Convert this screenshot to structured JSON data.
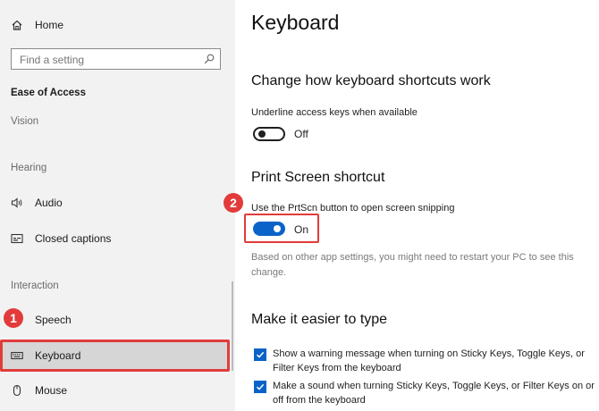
{
  "sidebar": {
    "home_label": "Home",
    "search_placeholder": "Find a setting",
    "category_title": "Ease of Access",
    "group_vision": "Vision",
    "group_hearing": "Hearing",
    "group_interaction": "Interaction",
    "items": {
      "audio": "Audio",
      "closed_captions": "Closed captions",
      "speech": "Speech",
      "keyboard": "Keyboard",
      "mouse": "Mouse"
    },
    "selected_item": "Keyboard"
  },
  "badges": {
    "first": "1",
    "second": "2"
  },
  "main": {
    "title": "Keyboard",
    "shortcuts_section": {
      "heading": "Change how keyboard shortcuts work",
      "underline_label": "Underline access keys when available",
      "underline_state": "Off"
    },
    "print_screen_section": {
      "heading": "Print Screen shortcut",
      "prtscn_label": "Use the PrtScn button to open screen snipping",
      "prtscn_state": "On",
      "note": "Based on other app settings, you might need to restart your PC to see this change."
    },
    "typing_section": {
      "heading": "Make it easier to type",
      "checkbox_warning": "Show a warning message when turning on Sticky Keys, Toggle Keys, or Filter Keys from the keyboard",
      "checkbox_sound": "Make a sound when turning Sticky Keys, Toggle Keys, or Filter Keys on or off from the keyboard"
    }
  },
  "colors": {
    "accent": "#0a63c9",
    "highlight": "#e23b3b",
    "sidebar_bg": "#f2f2f2"
  }
}
